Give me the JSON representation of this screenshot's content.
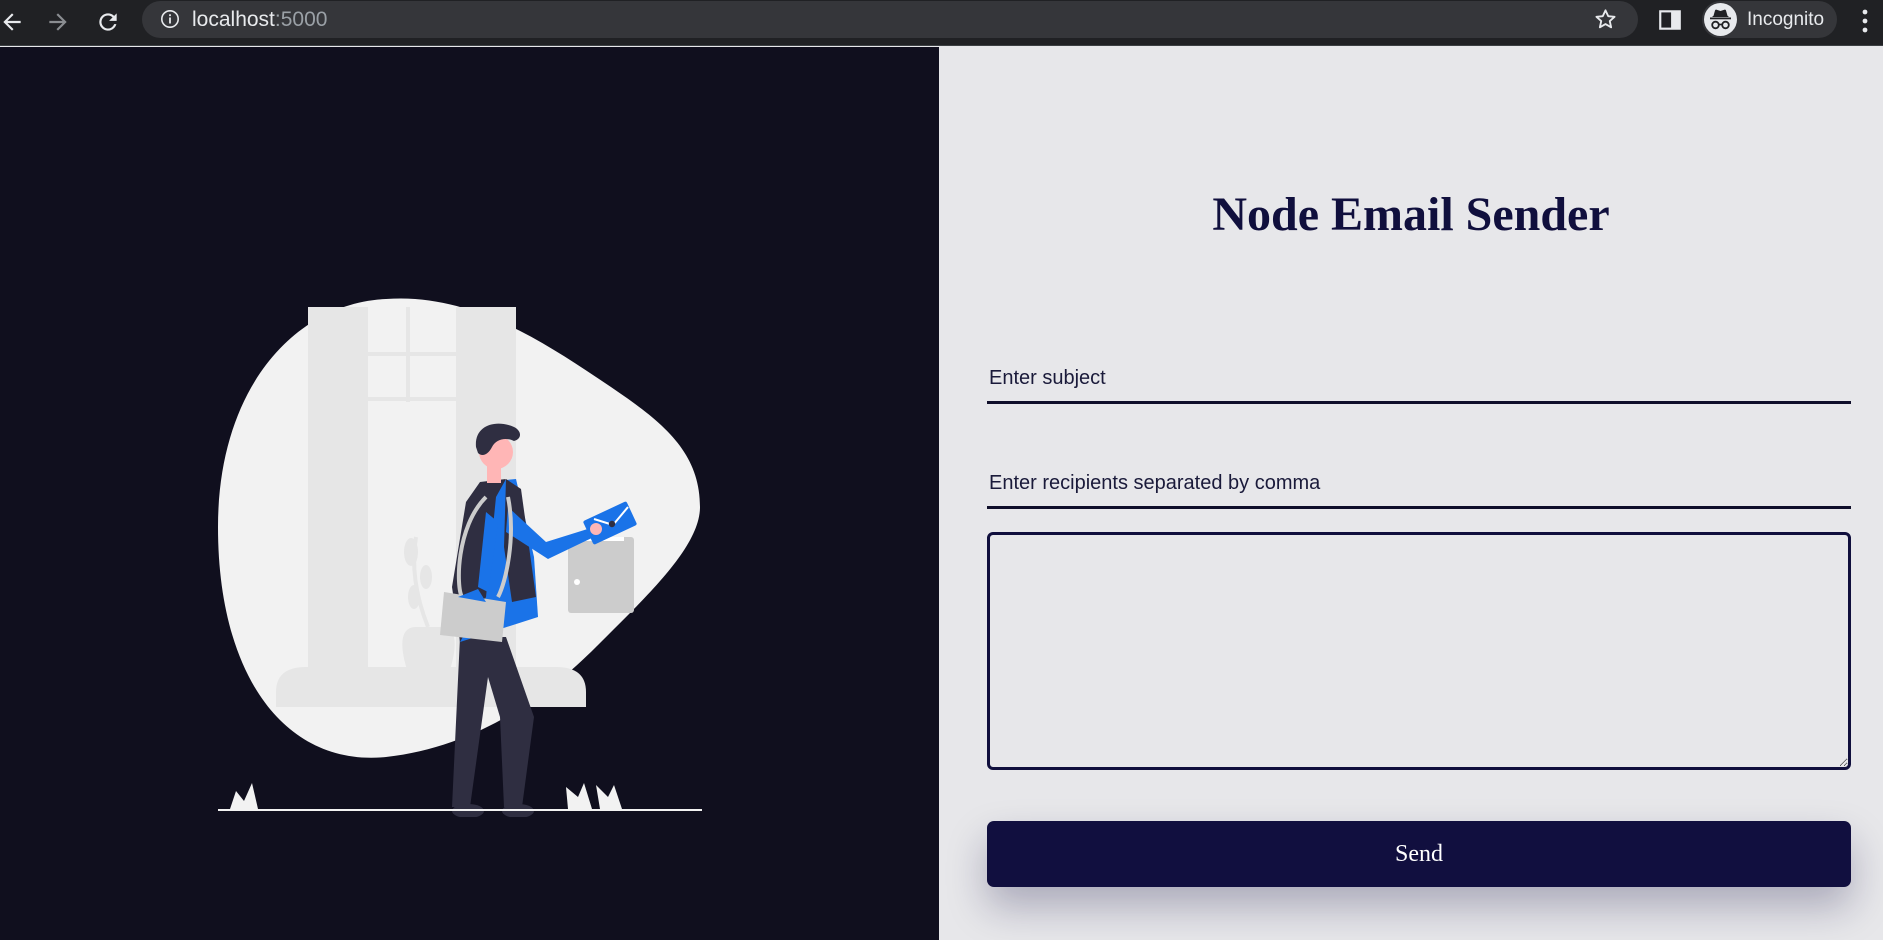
{
  "browser": {
    "url_host": "localhost",
    "url_port": ":5000",
    "profile_label": "Incognito",
    "icons": {
      "back": "arrow-left-icon",
      "forward": "arrow-right-icon",
      "reload": "reload-icon",
      "info": "info-icon",
      "bookmark": "star-icon",
      "side_panel": "side-panel-icon",
      "incognito": "incognito-icon",
      "menu": "kebab-menu-icon"
    }
  },
  "page": {
    "title": "Node Email Sender",
    "form": {
      "subject_placeholder": "Enter subject",
      "subject_value": "",
      "recipients_placeholder": "Enter recipients separated by comma",
      "recipients_value": "",
      "message_value": "",
      "send_label": "Send"
    }
  },
  "colors": {
    "left_panel_bg": "#100f1e",
    "right_panel_bg": "#e7e7ea",
    "accent": "#110f3f",
    "illustration_blue": "#1a73e8"
  }
}
